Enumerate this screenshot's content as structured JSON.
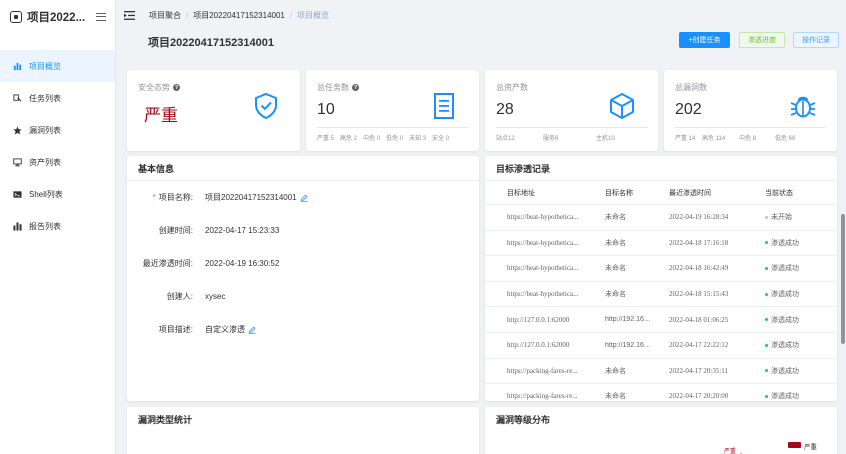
{
  "app": {
    "title": "项目2022..."
  },
  "sidebar": {
    "items": [
      {
        "label": "项目概览",
        "icon": "bar-chart-icon",
        "active": true
      },
      {
        "label": "任务列表",
        "icon": "task-list-icon",
        "active": false
      },
      {
        "label": "漏洞列表",
        "icon": "star-icon",
        "active": false
      },
      {
        "label": "资产列表",
        "icon": "monitor-icon",
        "active": false
      },
      {
        "label": "Shell列表",
        "icon": "terminal-icon",
        "active": false
      },
      {
        "label": "报告列表",
        "icon": "report-chart-icon",
        "active": false
      }
    ]
  },
  "breadcrumb": {
    "items": [
      "项目聚合",
      "项目20220417152314001",
      "项目概览"
    ]
  },
  "page": {
    "title": "项目20220417152314001",
    "buttons": {
      "create_task": "+创建任务",
      "pentest_progress": "渗透进度",
      "operation_log": "操作记录"
    }
  },
  "stats": {
    "security": {
      "title": "安全态势",
      "value": "严重"
    },
    "tasks": {
      "title": "总任务数",
      "value": "10",
      "breakdown": [
        "严重 5",
        "高危 2",
        "中危 0",
        "低危 0",
        "未知 3",
        "安全 0"
      ]
    },
    "assets": {
      "title": "总资产数",
      "value": "28",
      "breakdown": [
        "站点12",
        "服务6",
        "主机10"
      ]
    },
    "vulns": {
      "title": "总漏洞数",
      "value": "202",
      "breakdown": [
        "严重 14",
        "高危 114",
        "中危 8",
        "低危 66"
      ]
    }
  },
  "basic_info": {
    "title": "基本信息",
    "rows": [
      {
        "label": "项目名称:",
        "value": "项目20220417152314001",
        "required": true,
        "editable": true
      },
      {
        "label": "创建时间:",
        "value": "2022-04-17 15:23:33"
      },
      {
        "label": "最近渗透时间:",
        "value": "2022-04-19 16:30:52"
      },
      {
        "label": "创建人:",
        "value": "xysec"
      },
      {
        "label": "项目描述:",
        "value": "自定义渗透",
        "editable": true
      }
    ]
  },
  "pentest_records": {
    "title": "目标渗透记录",
    "columns": [
      "目标地址",
      "目标名称",
      "最近渗透时间",
      "当前状态"
    ],
    "rows": [
      {
        "address": "https://beat-hypothetica...",
        "name": "未命名",
        "time": "2022-04-19 16:28:34",
        "status": "未开始",
        "status_color": "#c0c4cc"
      },
      {
        "address": "https://beat-hypothetica...",
        "name": "未命名",
        "time": "2022-04-18 17:16:18",
        "status": "渗透成功",
        "status_color": "#13ce66"
      },
      {
        "address": "https://beat-hypothetica...",
        "name": "未命名",
        "time": "2022-04-18 16:42:49",
        "status": "渗透成功",
        "status_color": "#13ce66"
      },
      {
        "address": "https://beat-hypothetica...",
        "name": "未命名",
        "time": "2022-04-18 15:15:43",
        "status": "渗透成功",
        "status_color": "#13ce66"
      },
      {
        "address": "http://127.0.0.1:62000",
        "name": "http://192.168....",
        "time": "2022-04-18 01:06:25",
        "status": "渗透成功",
        "status_color": "#13ce66"
      },
      {
        "address": "http://127.0.0.1:62000",
        "name": "http://192.168....",
        "time": "2022-04-17 22:22:12",
        "status": "渗透成功",
        "status_color": "#13ce66"
      },
      {
        "address": "https://packing-fares-re...",
        "name": "未命名",
        "time": "2022-04-17 20:35:11",
        "status": "渗透成功",
        "status_color": "#13ce66"
      },
      {
        "address": "https://packing-fares-re...",
        "name": "未命名",
        "time": "2022-04-17 20:20:00",
        "status": "渗透成功",
        "status_color": "#13ce66"
      }
    ]
  },
  "vuln_type_stats": {
    "title": "漏洞类型统计"
  },
  "vuln_level_dist": {
    "title": "漏洞等级分布",
    "legend": [
      "严重"
    ],
    "labels": [
      "严重"
    ]
  },
  "colors": {
    "accent": "#1890ff",
    "danger": "#a8071a",
    "success": "#13ce66",
    "muted": "#909399"
  }
}
